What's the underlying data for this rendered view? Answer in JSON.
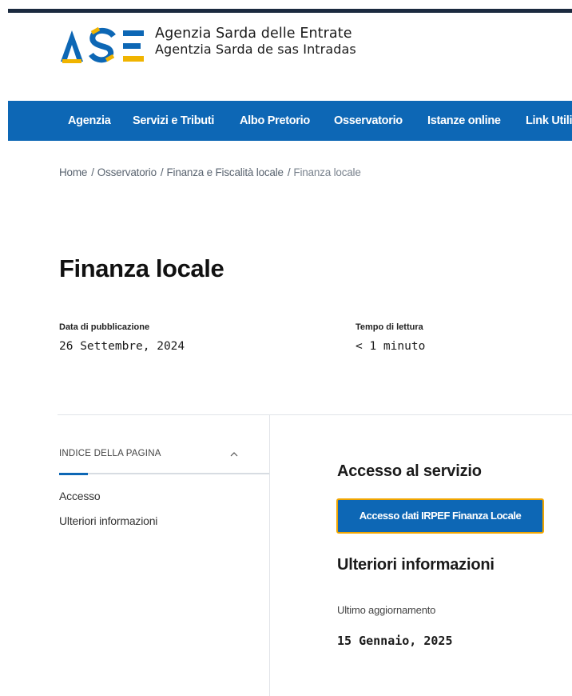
{
  "header": {
    "logo_text": "ASE",
    "brand_line1": "Agenzia Sarda delle Entrate",
    "brand_line2": "Agentzia Sarda de sas Intradas",
    "colors": {
      "blue": "#0d67b5",
      "gold": "#f0b400",
      "dark": "#1b2a3f"
    }
  },
  "nav": {
    "items": [
      {
        "label": "Agenzia"
      },
      {
        "label": "Servizi e Tributi"
      },
      {
        "label": "Albo Pretorio"
      },
      {
        "label": "Osservatorio"
      },
      {
        "label": "Istanze online"
      },
      {
        "label": "Link Utili"
      }
    ]
  },
  "breadcrumb": {
    "items": [
      {
        "label": "Home"
      },
      {
        "label": "Osservatorio"
      },
      {
        "label": "Finanza e Fiscalità locale"
      },
      {
        "label": "Finanza locale"
      }
    ],
    "separator": "/"
  },
  "page": {
    "title": "Finanza locale",
    "publication_label": "Data di pubblicazione",
    "publication_value": "26 Settembre, 2024",
    "reading_label": "Tempo di lettura",
    "reading_value": "< 1 minuto"
  },
  "toc": {
    "heading": "INDICE DELLA PAGINA",
    "chevron_icon": "chevron-up-icon",
    "items": [
      {
        "label": "Accesso"
      },
      {
        "label": "Ulteriori informazioni"
      }
    ]
  },
  "content": {
    "access_title": "Accesso al servizio",
    "access_button": "Accesso dati IRPEF Finanza Locale",
    "more_info_title": "Ulteriori informazioni",
    "last_update_label": "Ultimo aggiornamento",
    "last_update_value": "15 Gennaio, 2025"
  }
}
